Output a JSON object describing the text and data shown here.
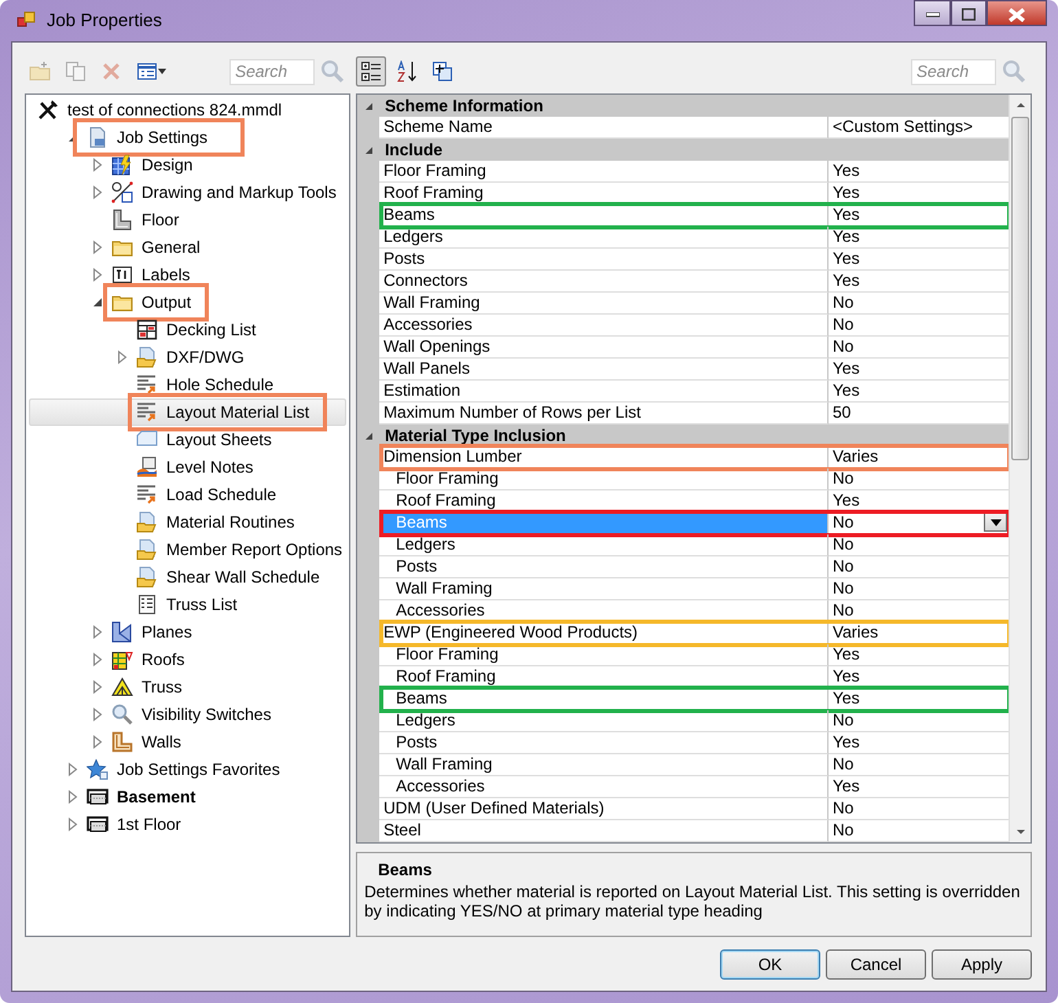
{
  "window": {
    "title": "Job Properties"
  },
  "left_toolbar": {
    "buttons": [
      {
        "kind": "new-folder",
        "disabled": true
      },
      {
        "kind": "copy",
        "disabled": true
      },
      {
        "kind": "delete",
        "disabled": true
      },
      {
        "kind": "view",
        "disabled": false
      }
    ],
    "search": {
      "placeholder": "Search"
    }
  },
  "tree": {
    "items": [
      {
        "label": "test of connections 824.mmdl",
        "kind": "tools",
        "selected": false,
        "children": [
          {
            "label": "Job Settings",
            "kind": "settings",
            "expanded": true,
            "selected": false,
            "color": "#f0845a",
            "children": [
              {
                "label": "Design",
                "kind": "design",
                "expanded": false,
                "selected": false
              },
              {
                "label": "Drawing and Markup Tools",
                "kind": "drawing",
                "expanded": false,
                "selected": false
              },
              {
                "label": "Floor",
                "kind": "floor",
                "selected": false
              },
              {
                "label": "General",
                "kind": "folder",
                "expanded": false,
                "selected": false
              },
              {
                "label": "Labels",
                "kind": "label",
                "expanded": false,
                "selected": false
              },
              {
                "label": "Output",
                "kind": "folder",
                "expanded": true,
                "selected": false,
                "color": "#f0845a",
                "children": [
                  {
                    "label": "Decking List",
                    "kind": "table",
                    "selected": false
                  },
                  {
                    "label": "DXF/DWG",
                    "kind": "docfolder",
                    "expanded": false,
                    "selected": false
                  },
                  {
                    "label": "Hole Schedule",
                    "kind": "report",
                    "selected": false
                  },
                  {
                    "label": "Layout Material List",
                    "kind": "report",
                    "selected": true,
                    "color": "#f0845a"
                  },
                  {
                    "label": "Layout Sheets",
                    "kind": "sheet",
                    "selected": false
                  },
                  {
                    "label": "Level Notes",
                    "kind": "notes",
                    "selected": false
                  },
                  {
                    "label": "Load Schedule",
                    "kind": "report",
                    "selected": false
                  },
                  {
                    "label": "Material Routines",
                    "kind": "docfolder",
                    "selected": false
                  },
                  {
                    "label": "Member Report Options",
                    "kind": "docfolder",
                    "selected": false
                  },
                  {
                    "label": "Shear Wall Schedule",
                    "kind": "docfolder",
                    "selected": false
                  },
                  {
                    "label": "Truss List",
                    "kind": "checklist",
                    "selected": false
                  }
                ]
              },
              {
                "label": "Planes",
                "kind": "planes",
                "expanded": false,
                "selected": false
              },
              {
                "label": "Roofs",
                "kind": "roofs",
                "expanded": false,
                "selected": false
              },
              {
                "label": "Truss",
                "kind": "truss",
                "expanded": false,
                "selected": false
              },
              {
                "label": "Visibility Switches",
                "kind": "magnifier",
                "expanded": false,
                "selected": false
              },
              {
                "label": "Walls",
                "kind": "walls",
                "expanded": false,
                "selected": false
              }
            ]
          },
          {
            "label": "Job Settings Favorites",
            "kind": "star",
            "expanded": false,
            "selected": false
          },
          {
            "label": "Basement",
            "kind": "level",
            "expanded": false,
            "selected": false,
            "bold": true
          },
          {
            "label": "1st Floor",
            "kind": "level",
            "expanded": false,
            "selected": false
          }
        ]
      }
    ]
  },
  "property_toolbar": {
    "buttons": [
      {
        "kind": "categorized",
        "pressed": true
      },
      {
        "kind": "alphabetical",
        "pressed": false
      },
      {
        "kind": "property-pages",
        "pressed": false
      }
    ],
    "search": {
      "placeholder": "Search"
    }
  },
  "property_grid": {
    "categories": [
      {
        "name": "Scheme Information",
        "expanded": true,
        "rows": [
          {
            "name": "Scheme Name",
            "value": "<Custom Settings>",
            "selected": false
          }
        ]
      },
      {
        "name": "Include",
        "expanded": true,
        "rows": [
          {
            "name": "Floor Framing",
            "value": "Yes",
            "selected": false
          },
          {
            "name": "Roof Framing",
            "value": "Yes",
            "selected": false
          },
          {
            "name": "Beams",
            "value": "Yes",
            "selected": false,
            "color": "#22b14c"
          },
          {
            "name": "Ledgers",
            "value": "Yes",
            "selected": false
          },
          {
            "name": "Posts",
            "value": "Yes",
            "selected": false
          },
          {
            "name": "Connectors",
            "value": "Yes",
            "selected": false
          },
          {
            "name": "Wall Framing",
            "value": "No",
            "selected": false
          },
          {
            "name": "Accessories",
            "value": "No",
            "selected": false
          },
          {
            "name": "Wall Openings",
            "value": "No",
            "selected": false
          },
          {
            "name": "Wall Panels",
            "value": "Yes",
            "selected": false
          },
          {
            "name": "Estimation",
            "value": "Yes",
            "selected": false
          },
          {
            "name": "Maximum Number of Rows per List",
            "value": "50",
            "selected": false
          }
        ]
      },
      {
        "name": "Material Type Inclusion",
        "expanded": true,
        "rows": [
          {
            "name": "Dimension Lumber",
            "value": "Varies",
            "selected": false,
            "color": "#f0845a",
            "children": [
              {
                "name": "Floor Framing",
                "value": "No",
                "selected": false
              },
              {
                "name": "Roof Framing",
                "value": "Yes",
                "selected": false
              },
              {
                "name": "Beams",
                "value": "No",
                "selected": true,
                "color": "#ed1c24"
              },
              {
                "name": "Ledgers",
                "value": "No",
                "selected": false
              },
              {
                "name": "Posts",
                "value": "No",
                "selected": false
              },
              {
                "name": "Wall Framing",
                "value": "No",
                "selected": false
              },
              {
                "name": "Accessories",
                "value": "No",
                "selected": false
              }
            ]
          },
          {
            "name": "EWP (Engineered Wood Products)",
            "value": "Varies",
            "selected": false,
            "color": "#f5b82a",
            "children": [
              {
                "name": "Floor Framing",
                "value": "Yes",
                "selected": false
              },
              {
                "name": "Roof Framing",
                "value": "Yes",
                "selected": false
              },
              {
                "name": "Beams",
                "value": "Yes",
                "selected": false,
                "color": "#22b14c"
              },
              {
                "name": "Ledgers",
                "value": "No",
                "selected": false
              },
              {
                "name": "Posts",
                "value": "Yes",
                "selected": false
              },
              {
                "name": "Wall Framing",
                "value": "No",
                "selected": false
              },
              {
                "name": "Accessories",
                "value": "Yes",
                "selected": false
              }
            ]
          },
          {
            "name": "UDM (User Defined Materials)",
            "value": "No",
            "selected": false
          },
          {
            "name": "Steel",
            "value": "No",
            "selected": false
          }
        ]
      }
    ]
  },
  "description": {
    "title": "Beams",
    "text": "Determines whether material is reported on Layout Material List. This setting is overridden by indicating YES/NO at primary material type heading"
  },
  "buttons": [
    {
      "label": "OK",
      "default": true
    },
    {
      "label": "Cancel",
      "default": false
    },
    {
      "label": "Apply",
      "default": false
    }
  ]
}
